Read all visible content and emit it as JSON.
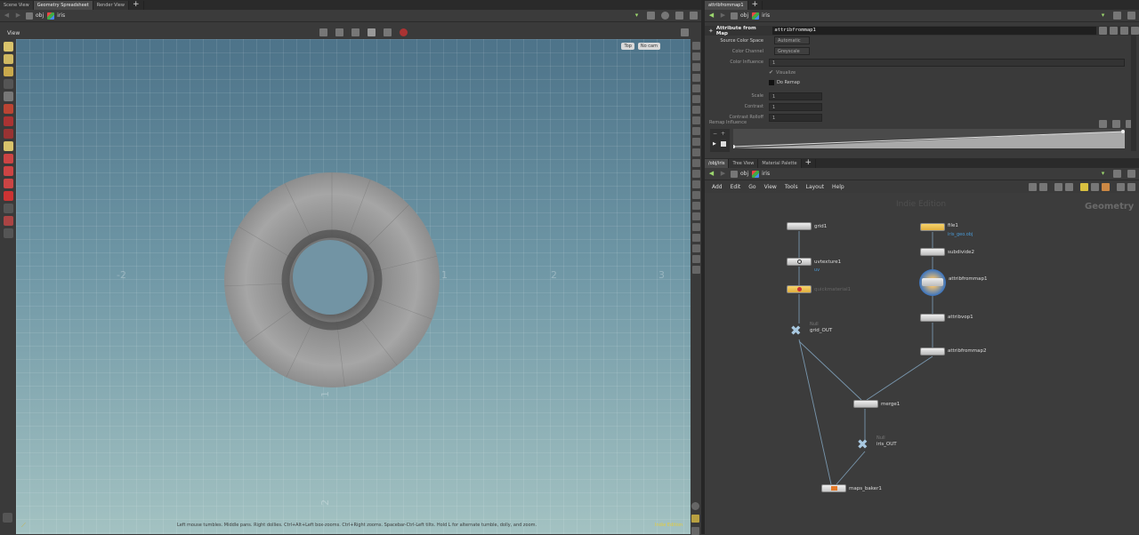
{
  "left_pane": {
    "tabs": [
      "Scene View",
      "Geometry Spreadsheet",
      "Render View",
      "+"
    ],
    "path": {
      "obj": "obj",
      "node": "iris"
    },
    "view_label": "View",
    "cam_top": "Top",
    "cam_nocam": "No cam",
    "axis_labels": {
      "xneg2": "-2",
      "x0": "0",
      "x1": "1",
      "x2": "2",
      "x3": "3",
      "z0": "0",
      "z1": "1",
      "z2": "2"
    },
    "status_bar": "Left mouse tumbles. Middle pans. Right dollies. Ctrl+Alt+Left box-zooms. Ctrl+Right zooms. Spacebar-Ctrl-Left tilts. Hold L for alternate tumble, dolly, and zoom.",
    "indie_badge": "Indie Edition"
  },
  "params_pane": {
    "tabs": [
      "attribfrommap1",
      "+"
    ],
    "path": {
      "obj": "obj",
      "node": "iris"
    },
    "node_type": "Attribute from Map",
    "node_name": "attribfrommap1",
    "rows": [
      {
        "label": "Source Color Space",
        "value": "Automatic"
      },
      {
        "label": "Color Channel",
        "value": "Greyscale"
      },
      {
        "label": "Color Influence",
        "value": "1"
      }
    ],
    "visualize": "Visualize",
    "do_remap": "Do Remap",
    "num_rows": [
      {
        "label": "Scale",
        "value": "1"
      },
      {
        "label": "Contrast",
        "value": "1"
      },
      {
        "label": "Contrast Rolloff",
        "value": "1"
      }
    ],
    "remap_influence": "Remap Influence"
  },
  "network_pane": {
    "tabs": [
      "/obj/iris",
      "Tree View",
      "Material Palette",
      "+"
    ],
    "path": {
      "obj": "obj",
      "node": "iris"
    },
    "menu": [
      "Add",
      "Edit",
      "Go",
      "View",
      "Tools",
      "Layout",
      "Help"
    ],
    "watermark": "Indie Edition",
    "context": "Geometry",
    "nodes": [
      {
        "id": "grid1",
        "label": "grid1",
        "sub": ""
      },
      {
        "id": "uvtexture1",
        "label": "uvtexture1",
        "sub": "uv"
      },
      {
        "id": "quickmaterial1",
        "label": "quickmaterial1",
        "sub": ""
      },
      {
        "id": "grid_out",
        "label": "grid_OUT",
        "sub": "Null"
      },
      {
        "id": "file1",
        "label": "file1",
        "sub": "iris_geo.obj"
      },
      {
        "id": "subdivide2",
        "label": "subdivide2",
        "sub": ""
      },
      {
        "id": "attribfrommap1",
        "label": "attribfrommap1",
        "sub": ""
      },
      {
        "id": "attribvop1",
        "label": "attribvop1",
        "sub": ""
      },
      {
        "id": "attribfrommap2",
        "label": "attribfrommap2",
        "sub": ""
      },
      {
        "id": "merge1",
        "label": "merge1",
        "sub": ""
      },
      {
        "id": "iris_out",
        "label": "iris_OUT",
        "sub": "Null"
      },
      {
        "id": "maps_baker1",
        "label": "maps_baker1",
        "sub": ""
      }
    ]
  }
}
